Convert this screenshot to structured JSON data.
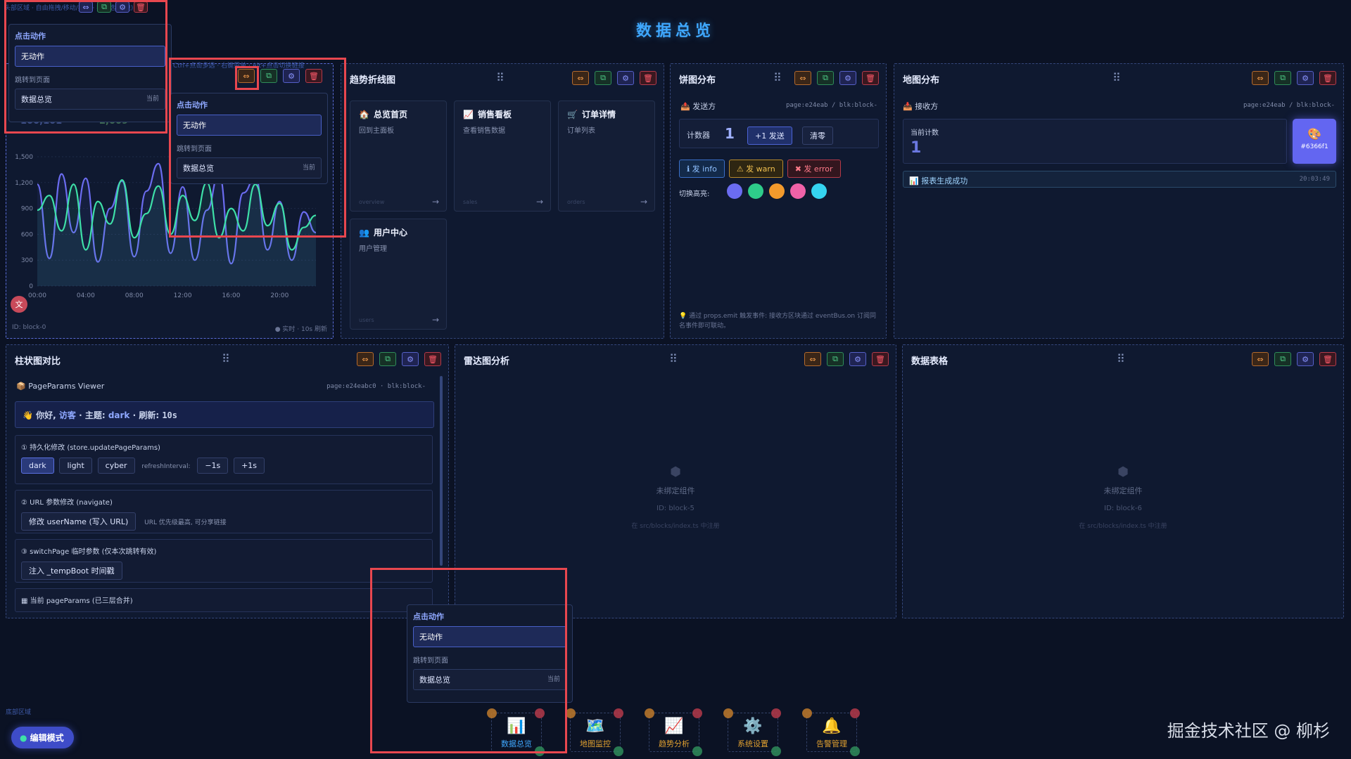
{
  "page_title": "数据总览",
  "top_hint": "头部区域 · 自由拖拽/移动/拉伸 · 拖拽选(拉拽)",
  "trend_hint": "Ctrl+点击多选 · 右键菜单 · Alt+点击切换链接",
  "colors": {
    "accent": "#3fa8ff",
    "line1": "#6b6cf0",
    "line2": "#3ee0a8",
    "red_box": "#e8474f"
  },
  "popup": {
    "action_label": "点击动作",
    "action_value": "无动作",
    "jump_label": "跳转到页面",
    "jump_value": "数据总览",
    "jump_tag": "当前"
  },
  "line_block": {
    "ghost_values": [
      "100,101",
      "2,009"
    ],
    "y_ticks": [
      "1,500",
      "1,200",
      "900",
      "600",
      "300",
      "0"
    ],
    "x_ticks": [
      "00:00",
      "04:00",
      "08:00",
      "12:00",
      "16:00",
      "20:00"
    ],
    "id": "ID: block-0",
    "live": "● 实时 · 10s 刷新"
  },
  "chart_data": {
    "type": "line",
    "x": [
      "00:00",
      "01:00",
      "02:00",
      "03:00",
      "04:00",
      "05:00",
      "06:00",
      "07:00",
      "08:00",
      "09:00",
      "10:00",
      "11:00",
      "12:00",
      "13:00",
      "14:00",
      "15:00",
      "16:00",
      "17:00",
      "18:00",
      "19:00",
      "20:00",
      "21:00",
      "22:00",
      "23:00"
    ],
    "series": [
      {
        "values": [
          1180,
          320,
          1300,
          620,
          1250,
          280,
          900,
          1220,
          340,
          1100,
          1420,
          380,
          1150,
          300,
          880,
          1300,
          260,
          1080,
          1260,
          420,
          980,
          300,
          860,
          620
        ]
      },
      {
        "values": [
          880,
          1050,
          640,
          1180,
          420,
          980,
          720,
          1230,
          560,
          840,
          1160,
          600,
          1050,
          760,
          1200,
          560,
          900,
          640,
          1180,
          700,
          960,
          420,
          680,
          820
        ]
      }
    ],
    "ylim": [
      0,
      1500
    ]
  },
  "blocks": {
    "trend_title": "趋势折线图",
    "pie_title": "饼图分布",
    "map_title": "地图分布",
    "bar_title": "柱状图对比",
    "radar_title": "雷达图分析",
    "table_title": "数据表格"
  },
  "nav_cards": [
    {
      "icon": "🏠",
      "title": "总览首页",
      "sub": "回到主面板",
      "foot": "overview"
    },
    {
      "icon": "📈",
      "title": "销售看板",
      "sub": "查看销售数据",
      "foot": "sales"
    },
    {
      "icon": "🛒",
      "title": "订单详情",
      "sub": "订单列表",
      "foot": "orders"
    },
    {
      "icon": "👥",
      "title": "用户中心",
      "sub": "用户管理",
      "foot": "users"
    }
  ],
  "pie": {
    "sender": "发送方",
    "path": "page:e24eab / blk:block-",
    "counter_label": "计数器",
    "counter_value": "1",
    "send_btn": "+1 发送",
    "clear_btn": "清零",
    "info_btn": "ℹ 发 info",
    "warn_btn": "⚠ 发 warn",
    "error_btn": "✖ 发 error",
    "switch_label": "切换高亮:",
    "swatches": [
      "#6b6cf0",
      "#2ecc8a",
      "#f39a2c",
      "#f062a8",
      "#35d4f0"
    ],
    "note": "💡 通过 props.emit 触发事件: 接收方区块通过 eventBus.on 订阅同名事件即可联动。"
  },
  "map": {
    "receiver": "接收方",
    "path": "page:e24eab / blk:block-",
    "count_label": "当前计数",
    "count_value": "1",
    "color_hex": "#6366f1",
    "log_text": "报表生成成功",
    "log_time": "20:03:49"
  },
  "bar": {
    "viewer_title": "PageParams Viewer",
    "viewer_path": "page:e24eabc0 · blk:block-",
    "greet_prefix": "👋 你好,",
    "greet_user": "访客",
    "greet_theme_label": "· 主题:",
    "greet_theme": "dark",
    "greet_refresh_label": "· 刷新:",
    "greet_refresh": "10s",
    "s1_title": "① 持久化修改 (store.updatePageParams)",
    "themes": [
      "dark",
      "light",
      "cyber"
    ],
    "refresh_label": "refreshInterval:",
    "minus": "−1s",
    "plus": "+1s",
    "s2_title": "② URL 参数修改 (navigate)",
    "s2_btn": "修改 userName (写入 URL)",
    "s2_note": "URL 优先级最高, 可分享链接",
    "s3_title": "③ switchPage 临时参数 (仅本次跳转有效)",
    "s3_btn": "注入 _tempBoot 时间戳",
    "s4_title": "当前 pageParams (已三层合并)"
  },
  "unbound": {
    "label": "未绑定组件",
    "radar_id": "ID: block-5",
    "table_id": "ID: block-6",
    "hint": "在 src/blocks/index.ts 中注册"
  },
  "footer_area": "底部区域",
  "edit_mode": "编辑模式",
  "dock": [
    {
      "icon": "📊",
      "label": "数据总览",
      "active": true
    },
    {
      "icon": "🗺️",
      "label": "地图监控",
      "active": false
    },
    {
      "icon": "📈",
      "label": "趋势分析",
      "active": false
    },
    {
      "icon": "⚙️",
      "label": "系统设置",
      "active": false
    },
    {
      "icon": "🔔",
      "label": "告警管理",
      "active": false
    }
  ],
  "watermark": "掘金技术社区 @ 柳杉"
}
